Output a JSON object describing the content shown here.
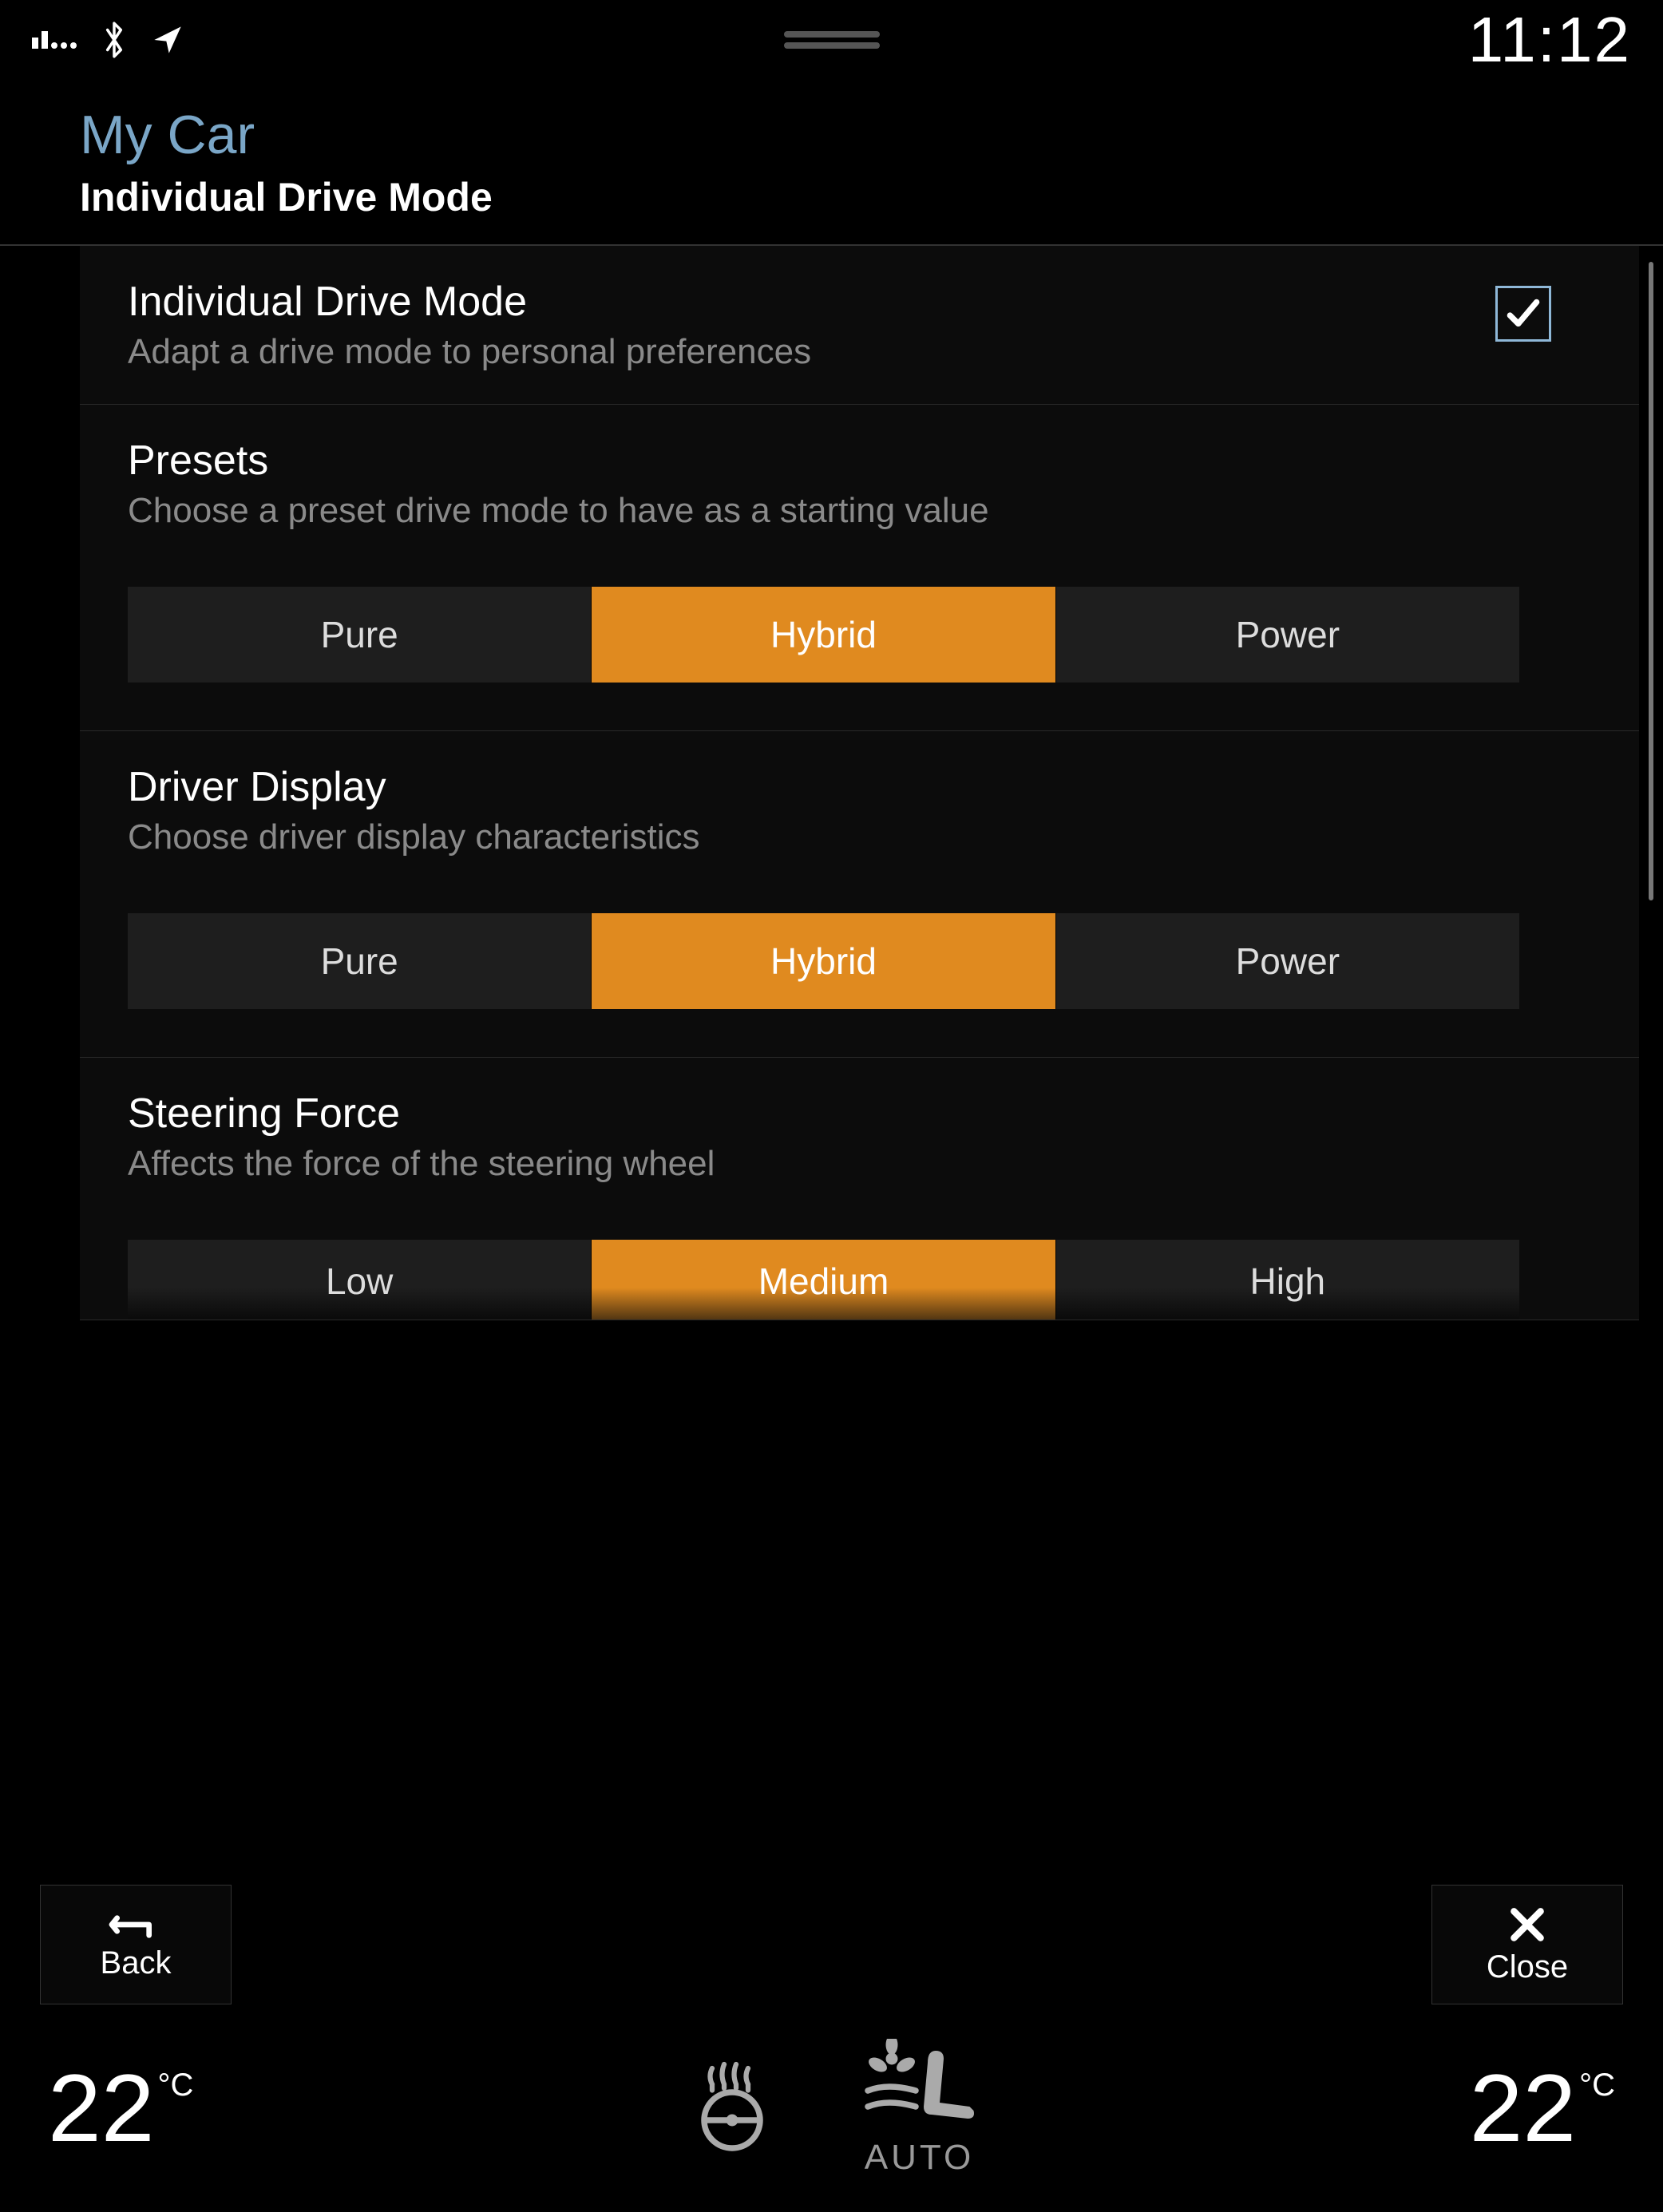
{
  "status": {
    "clock": "11:12"
  },
  "header": {
    "breadcrumb": "My Car",
    "title": "Individual Drive Mode"
  },
  "sections": {
    "idm": {
      "title": "Individual Drive Mode",
      "desc": "Adapt a drive mode to personal preferences",
      "checked": true
    },
    "presets": {
      "title": "Presets",
      "desc": "Choose a preset drive mode to have as a starting value",
      "options": [
        "Pure",
        "Hybrid",
        "Power"
      ],
      "selected": "Hybrid"
    },
    "driverDisplay": {
      "title": "Driver Display",
      "desc": "Choose driver display characteristics",
      "options": [
        "Pure",
        "Hybrid",
        "Power"
      ],
      "selected": "Hybrid"
    },
    "steering": {
      "title": "Steering Force",
      "desc": "Affects the force of the steering wheel",
      "options": [
        "Low",
        "Medium",
        "High"
      ],
      "selected": "Medium"
    }
  },
  "nav": {
    "back": "Back",
    "close": "Close"
  },
  "climate": {
    "left_temp": "22",
    "right_temp": "22",
    "unit": "°C",
    "auto": "AUTO"
  }
}
